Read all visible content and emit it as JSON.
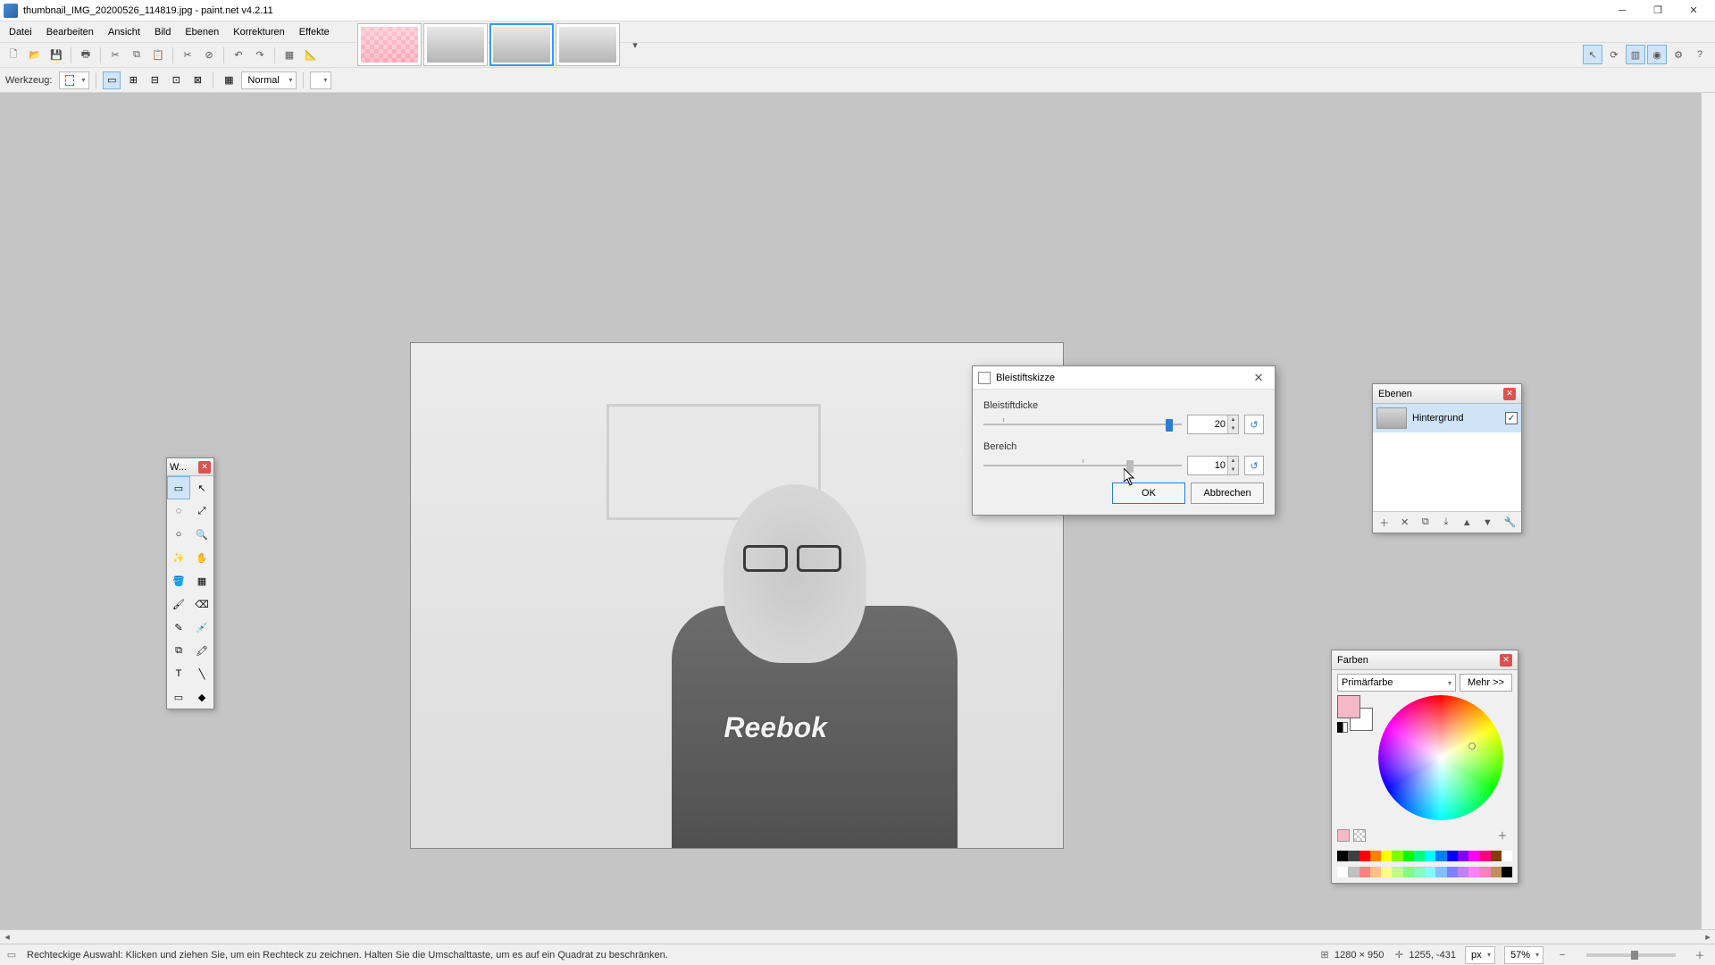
{
  "app": {
    "title": "thumbnail_IMG_20200526_114819.jpg - paint.net v4.2.11"
  },
  "menu": {
    "items": [
      "Datei",
      "Bearbeiten",
      "Ansicht",
      "Bild",
      "Ebenen",
      "Korrekturen",
      "Effekte"
    ]
  },
  "toolbar2": {
    "label": "Werkzeug:",
    "blend_label": "Normal"
  },
  "dialog": {
    "title": "Bleistiftskizze",
    "param1_label": "Bleistiftdicke",
    "param1_value": "20",
    "param2_label": "Bereich",
    "param2_value": "10",
    "ok": "OK",
    "cancel": "Abbrechen"
  },
  "layers": {
    "title": "Ebenen",
    "items": [
      {
        "name": "Hintergrund",
        "visible": true
      }
    ]
  },
  "colors": {
    "title": "Farben",
    "selector": "Primärfarbe",
    "more": "Mehr >>",
    "primary_hex": "#f5b8c6",
    "secondary_hex": "#ffffff",
    "palette": [
      "#000000",
      "#404040",
      "#ff0000",
      "#ff8000",
      "#ffff00",
      "#80ff00",
      "#00ff00",
      "#00ff80",
      "#00ffff",
      "#0080ff",
      "#0000ff",
      "#8000ff",
      "#ff00ff",
      "#ff0080",
      "#804000",
      "#ffffff"
    ],
    "palette2": [
      "#ffffff",
      "#c0c0c0",
      "#ff8080",
      "#ffc080",
      "#ffff80",
      "#c0ff80",
      "#80ff80",
      "#80ffc0",
      "#80ffff",
      "#80c0ff",
      "#8080ff",
      "#c080ff",
      "#ff80ff",
      "#ff80c0",
      "#c09058",
      "#000000"
    ]
  },
  "tools_window": {
    "title": "W..."
  },
  "status": {
    "hint": "Rechteckige Auswahl: Klicken und ziehen Sie, um ein Rechteck zu zeichnen. Halten Sie die Umschalttaste, um es auf ein Quadrat zu beschränken.",
    "image_size": "1280 × 950",
    "cursor_pos": "1255, -431",
    "units": "px",
    "zoom": "57%"
  },
  "canvas": {
    "shirt_text": "Reebok"
  }
}
